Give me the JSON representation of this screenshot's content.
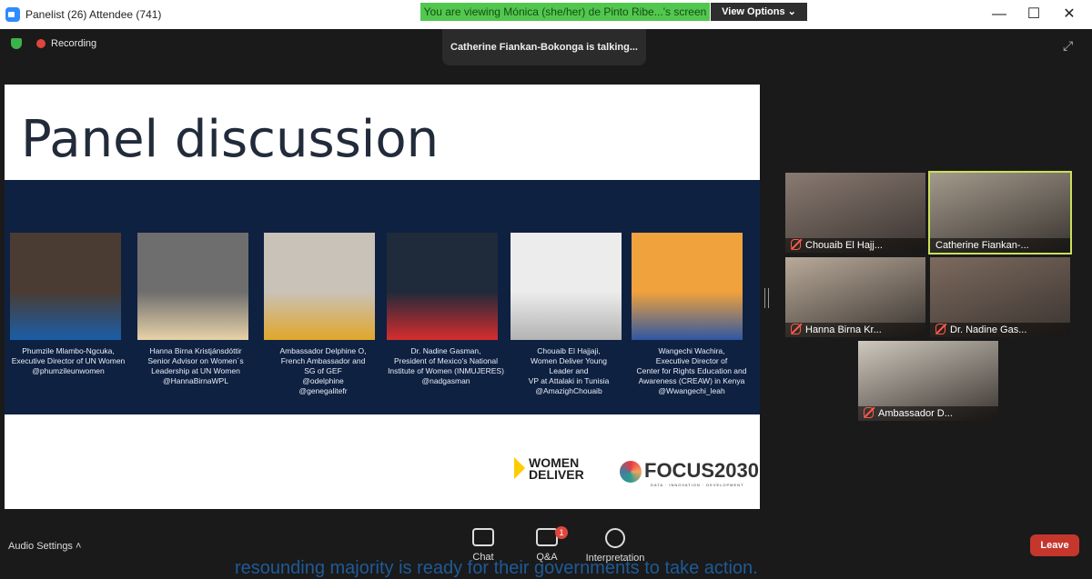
{
  "titlebar": {
    "title": "Panelist (26) Attendee (741)"
  },
  "share_banner": {
    "text": "You are viewing Mónica (she/her) de Pinto Ribe...'s screen",
    "options_label": "View Options ⌄"
  },
  "window_controls": {
    "minimize": "—",
    "maximize": "☐",
    "close": "✕"
  },
  "status": {
    "recording_label": "Recording",
    "talking_toast": "Catherine Fiankan-Bokonga is talking..."
  },
  "slide": {
    "title": "Panel discussion",
    "panelists": [
      {
        "caption": "Phumzile Mlambo-Ngcuka,\nExecutive Director of UN Women\n@phumzileunwomen",
        "photo_bg": "#4a3c33",
        "accent": "#1a5ea8"
      },
      {
        "caption": "Hanna Birna Kristjánsdóttir\nSenior Advisor on Women´s\nLeadership at UN Women\n@HannaBirnaWPL",
        "photo_bg": "#6e6e6e",
        "accent": "#e8d2a8"
      },
      {
        "caption": "Ambassador Delphine O,\nFrench Ambassador and\nSG of GEF\n@odelphine\n@genegalitefr",
        "photo_bg": "#c9c2b8",
        "accent": "#e0a72a"
      },
      {
        "caption": "Dr. Nadine Gasman,\nPresident of Mexico's National\nInstitute of Women (INMUJERES)\n@nadgasman",
        "photo_bg": "#1f2a3a",
        "accent": "#d72d2d"
      },
      {
        "caption": "Chouaib El Hajjaji,\nWomen Deliver Young\nLeader and\nVP at Attalaki in Tunisia\n@AmazighChouaib",
        "photo_bg": "#ececec",
        "accent": "#b3b3b3"
      },
      {
        "caption": "Wangechi Wachira,\nExecutive Director of\nCenter for Rights Education and\nAwareness (CREAW) in Kenya\n@Wwangechi_leah",
        "photo_bg": "#f0a23c",
        "accent": "#2f57a3"
      }
    ],
    "logo_women_deliver": [
      "WOMEN",
      "DELIVER"
    ],
    "logo_focus": "FOCUS2030",
    "logo_focus_sub": "DATA · INNOVATION · DEVELOPMENT"
  },
  "gallery": [
    {
      "name": "Chouaib El Hajj...",
      "bg": "#8a7a72"
    },
    {
      "name": "Catherine Fiankan-...",
      "bg": "#a39a8c"
    },
    {
      "name": "Hanna Birna Kr...",
      "bg": "#b9aa9a"
    },
    {
      "name": "Dr. Nadine Gas...",
      "bg": "#7c6a5e"
    },
    {
      "name": "Ambassador D...",
      "bg": "#cfc8bd"
    }
  ],
  "toolbar": {
    "audio_settings": "Audio Settings ˄",
    "chat": "Chat",
    "qa": "Q&A",
    "qa_badge": "1",
    "interpretation": "Interpretation",
    "leave": "Leave"
  },
  "background_text": "resounding majority is ready for their governments to take action."
}
